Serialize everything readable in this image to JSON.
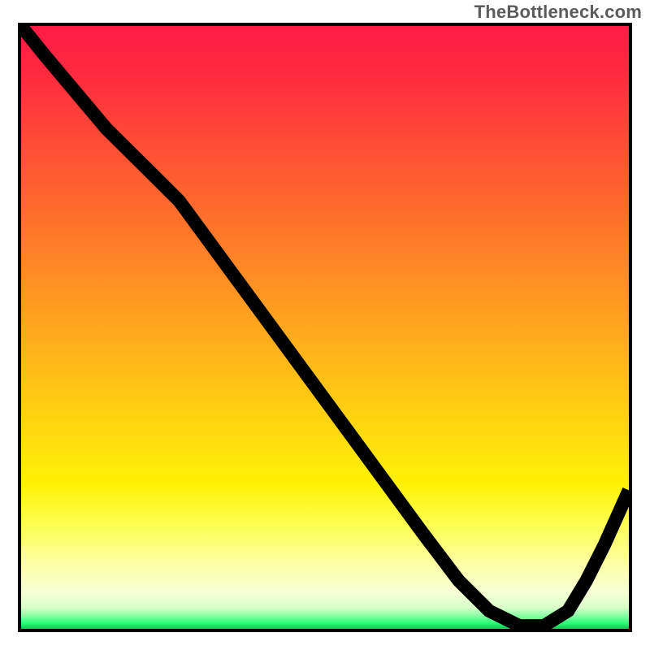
{
  "watermark": "TheBottleneck.com",
  "trough_label": "",
  "colors": {
    "frame": "#000000",
    "curve": "#000000",
    "gradient_top": "#ff1a46",
    "gradient_mid": "#ffd60f",
    "gradient_bottom": "#07cc4f",
    "label": "#c83a3a"
  },
  "chart_data": {
    "type": "line",
    "title": "",
    "xlabel": "",
    "ylabel": "",
    "xlim": [
      0,
      100
    ],
    "ylim": [
      0,
      100
    ],
    "grid": false,
    "legend": false,
    "notes": "Values digitised from pixel positions; y is read from top of plot (0) to bottom (100).",
    "series": [
      {
        "name": "bottleneck-curve",
        "x": [
          0.0,
          4.0,
          9.0,
          14.0,
          20.0,
          26.0,
          34.0,
          42.0,
          50.0,
          58.0,
          66.0,
          72.0,
          77.0,
          82.0,
          86.0,
          90.0,
          93.0,
          96.0,
          100.0
        ],
        "y": [
          0.0,
          5.0,
          11.0,
          17.0,
          23.0,
          29.0,
          40.0,
          51.0,
          62.0,
          73.0,
          84.0,
          92.0,
          97.0,
          99.5,
          99.5,
          97.0,
          92.0,
          86.0,
          77.0
        ]
      }
    ],
    "annotations": [
      {
        "type": "flat-trough",
        "x_start": 77.0,
        "x_end": 86.0,
        "y": 99.5
      }
    ]
  }
}
